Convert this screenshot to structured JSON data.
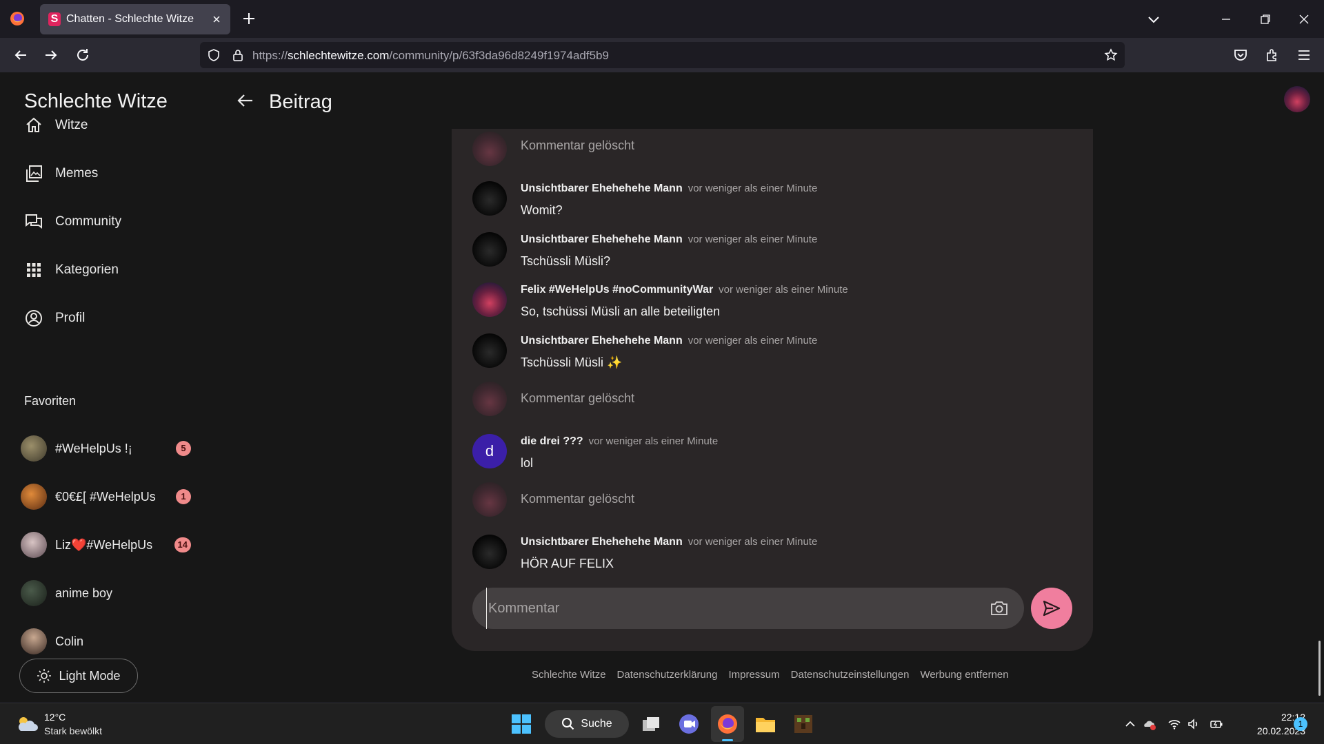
{
  "browser": {
    "tab_title": "Chatten - Schlechte Witze",
    "tab_favicon_letter": "S",
    "url_prefix": "https://",
    "url_host": "schlechtewitze.com",
    "url_path": "/community/p/63f3da96d8249f1974adf5b9"
  },
  "sidebar": {
    "site_title": "Schlechte Witze",
    "nav": [
      {
        "label": "Witze",
        "icon": "home-icon"
      },
      {
        "label": "Memes",
        "icon": "gallery-icon"
      },
      {
        "label": "Community",
        "icon": "chat-icon"
      },
      {
        "label": "Kategorien",
        "icon": "grid-icon"
      },
      {
        "label": "Profil",
        "icon": "profile-icon"
      }
    ],
    "favorites_title": "Favoriten",
    "favorites": [
      {
        "name": "#WeHelpUs !¡",
        "badge": "5"
      },
      {
        "name": "€0€£[ #WeHelpUs",
        "badge": "1"
      },
      {
        "name": "Liz❤️#WeHelpUs",
        "badge": "14"
      },
      {
        "name": "anime boy",
        "badge": ""
      },
      {
        "name": "Colin",
        "badge": ""
      }
    ],
    "light_mode_label": "Light Mode"
  },
  "header": {
    "title": "Beitrag"
  },
  "comments": [
    {
      "deleted": true,
      "text": "Kommentar gelöscht"
    },
    {
      "deleted": false,
      "author": "Unsichtbarer Ehehehehe Mann",
      "time": "vor weniger als einer Minute",
      "text": "Womit?"
    },
    {
      "deleted": false,
      "author": "Unsichtbarer Ehehehehe Mann",
      "time": "vor weniger als einer Minute",
      "text": "Tschüssli Müsli?"
    },
    {
      "deleted": false,
      "author": "Felix #WeHelpUs #noCommunityWar",
      "time": "vor weniger als einer Minute",
      "text": "So, tschüssi Müsli an alle beteiligten"
    },
    {
      "deleted": false,
      "author": "Unsichtbarer Ehehehehe Mann",
      "time": "vor weniger als einer Minute",
      "text": "Tschüssli Müsli ✨"
    },
    {
      "deleted": true,
      "text": "Kommentar gelöscht"
    },
    {
      "deleted": false,
      "author": "die drei ???",
      "time": "vor weniger als einer Minute",
      "text": "lol",
      "avatar_letter": "d"
    },
    {
      "deleted": true,
      "text": "Kommentar gelöscht"
    },
    {
      "deleted": false,
      "author": "Unsichtbarer Ehehehehe Mann",
      "time": "vor weniger als einer Minute",
      "text": "HÖR AUF FELIX"
    }
  ],
  "composer": {
    "placeholder": "Kommentar",
    "value": ""
  },
  "footer": {
    "links": [
      "Schlechte Witze",
      "Datenschutzerklärung",
      "Impressum",
      "Datenschutzeinstellungen",
      "Werbung entfernen"
    ]
  },
  "taskbar": {
    "weather_temp": "12°C",
    "weather_desc": "Stark bewölkt",
    "search_label": "Suche",
    "time": "22:12",
    "date": "20.02.2023",
    "notification_count": "1"
  },
  "colors": {
    "accent": "#f07e9e",
    "badge": "#f08a8a",
    "card": "#2a2627",
    "page": "#171717"
  }
}
